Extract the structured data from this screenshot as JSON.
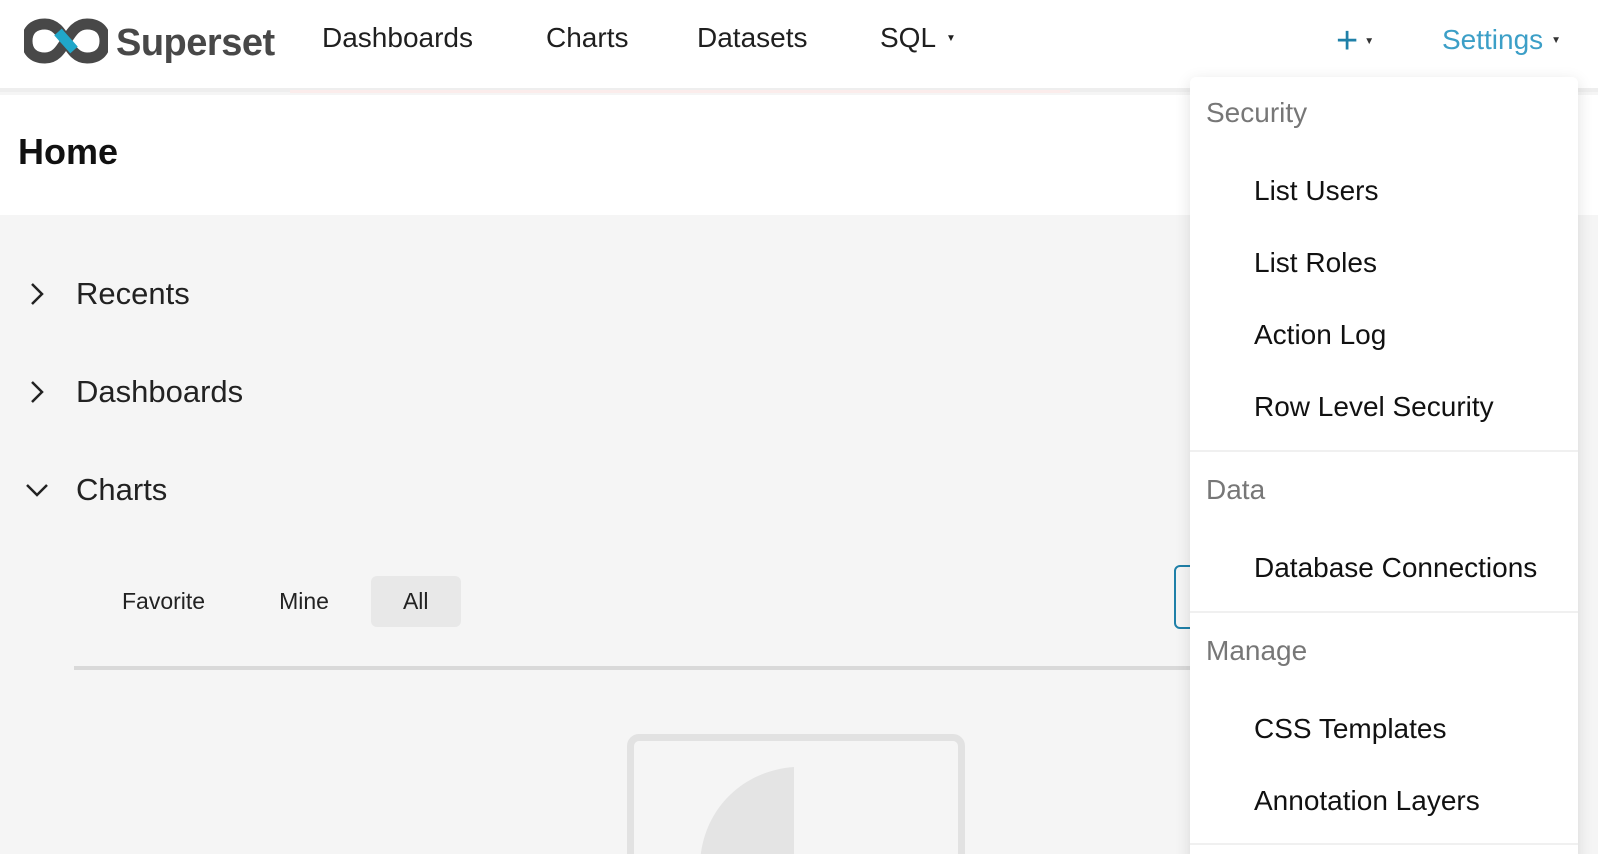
{
  "brand": {
    "name": "Superset"
  },
  "nav": {
    "dashboards": "Dashboards",
    "charts": "Charts",
    "datasets": "Datasets",
    "sql": "SQL"
  },
  "actions": {
    "plus": "+",
    "settings": "Settings"
  },
  "page": {
    "title": "Home"
  },
  "sections": {
    "recents": "Recents",
    "dashboards": "Dashboards",
    "charts": "Charts"
  },
  "tabs": {
    "favorite": "Favorite",
    "mine": "Mine",
    "all": "All",
    "selected": "All"
  },
  "settings_menu": {
    "security": {
      "title": "Security",
      "items": [
        "List Users",
        "List Roles",
        "Action Log",
        "Row Level Security"
      ]
    },
    "data": {
      "title": "Data",
      "items": [
        "Database Connections"
      ]
    },
    "manage": {
      "title": "Manage",
      "items": [
        "CSS Templates",
        "Annotation Layers"
      ]
    }
  },
  "colors": {
    "accent": "#1f80a8",
    "settings_link": "#3c9fc7"
  }
}
